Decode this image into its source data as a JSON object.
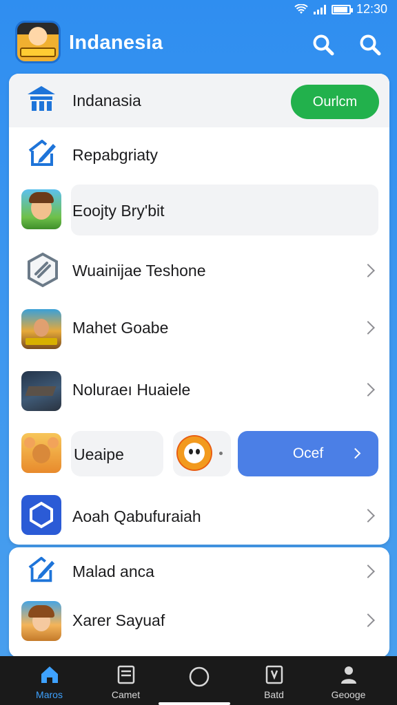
{
  "status_bar": {
    "time": "12:30"
  },
  "header": {
    "title": "Indanesia"
  },
  "main_list": {
    "rows": [
      {
        "label": "Indanasia",
        "button": "Ourlcm"
      },
      {
        "label": "Repabgriaty"
      },
      {
        "label": "Eoojty Bry'bit"
      },
      {
        "label": "Wuainijae Teshone"
      },
      {
        "label": "Mahet Goabe"
      },
      {
        "label": "Noluraeı Huaiele"
      },
      {
        "label": "Ueaipe",
        "button": "Ocef"
      },
      {
        "label": "Aoah Qabufuraiah"
      }
    ]
  },
  "secondary_list": {
    "rows": [
      {
        "label": "Malad anca"
      },
      {
        "label": "Xarer Sayuaf"
      }
    ]
  },
  "bottom_nav": {
    "items": [
      {
        "label": "Maros"
      },
      {
        "label": "Camet"
      },
      {
        "label": ""
      },
      {
        "label": "Batd"
      },
      {
        "label": "Geooge"
      }
    ]
  },
  "colors": {
    "accent_blue": "#2f8ef0",
    "green_button": "#22b14c",
    "blue_button": "#4b7fe6",
    "active_nav": "#3ea2ff"
  }
}
